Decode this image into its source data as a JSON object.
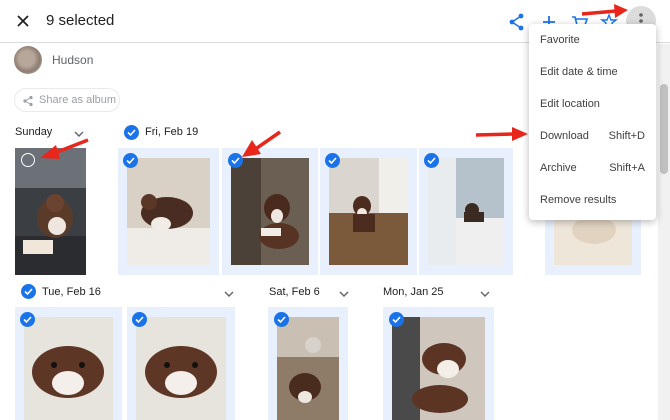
{
  "header": {
    "selected_text": "9 selected"
  },
  "person": {
    "name": "Hudson"
  },
  "share_album": {
    "label": "Share as album"
  },
  "dates": {
    "sunday": "Sunday",
    "fri_feb19": "Fri, Feb 19",
    "tue_feb16": "Tue, Feb 16",
    "sat_feb6": "Sat, Feb 6",
    "mon_jan25": "Mon, Jan 25"
  },
  "menu": {
    "items": [
      {
        "label": "Favorite",
        "shortcut": ""
      },
      {
        "label": "Edit date & time",
        "shortcut": ""
      },
      {
        "label": "Edit location",
        "shortcut": ""
      },
      {
        "label": "Download",
        "shortcut": "Shift+D"
      },
      {
        "label": "Archive",
        "shortcut": "Shift+A"
      },
      {
        "label": "Remove results",
        "shortcut": ""
      }
    ]
  },
  "colors": {
    "accent": "#1a73e8",
    "annotation_arrow": "#e8261c",
    "selected_tile_bg": "#e8f0fe"
  }
}
